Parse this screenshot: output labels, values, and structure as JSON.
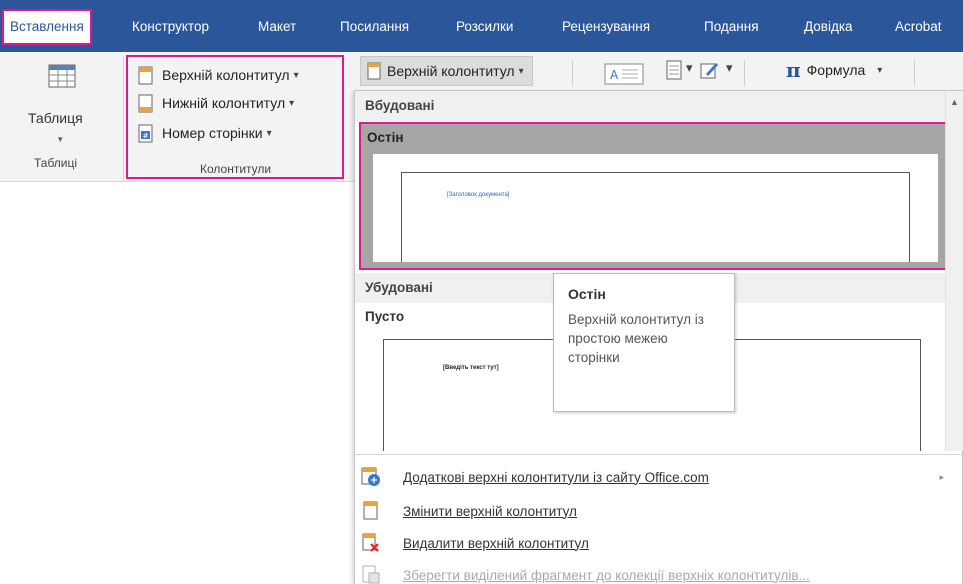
{
  "tabs": [
    {
      "label": "Вставлення",
      "active": true
    },
    {
      "label": "Конструктор"
    },
    {
      "label": "Макет"
    },
    {
      "label": "Посилання"
    },
    {
      "label": "Розсилки"
    },
    {
      "label": "Рецензування"
    },
    {
      "label": "Подання"
    },
    {
      "label": "Довідка"
    },
    {
      "label": "Acrobat"
    }
  ],
  "ribbon": {
    "table_group": {
      "button_label": "Таблиця",
      "group_label": "Таблиці"
    },
    "hf_group": {
      "header_label": "Верхній колонтитул",
      "footer_label": "Нижній колонтитул",
      "page_number_label": "Номер сторінки",
      "group_label": "Колонтитули"
    },
    "right": {
      "header_dropdown_label": "Верхній колонтитул",
      "formula_label": "Формула",
      "pi_symbol": "π"
    }
  },
  "dropdown": {
    "section_builtin": "Вбудовані",
    "item_selected_title": "Остін",
    "item_selected_placeholder": "[Заголовок документа]",
    "section_builtin2": "Убудовані",
    "item_blank_title": "Пусто",
    "item_blank_placeholder": "[Введіть текст тут]",
    "menu": [
      {
        "label": "Додаткові верхні колонтитули із сайту Office.com",
        "icon": "office-web-icon",
        "submenu": true
      },
      {
        "label": "Змінити верхній колонтитул",
        "icon": "edit-header-icon"
      },
      {
        "label": "Видалити верхній колонтитул",
        "icon": "remove-header-icon"
      },
      {
        "label": "Зберегти виділений фрагмент до колекції верхніх колонтитулів...",
        "icon": "save-selection-icon",
        "disabled": true
      }
    ]
  },
  "tooltip": {
    "title": "Остін",
    "body": "Верхній колонтитул із простою межею сторінки"
  },
  "colors": {
    "accent": "#2b579a",
    "highlight": "#e0188b"
  }
}
